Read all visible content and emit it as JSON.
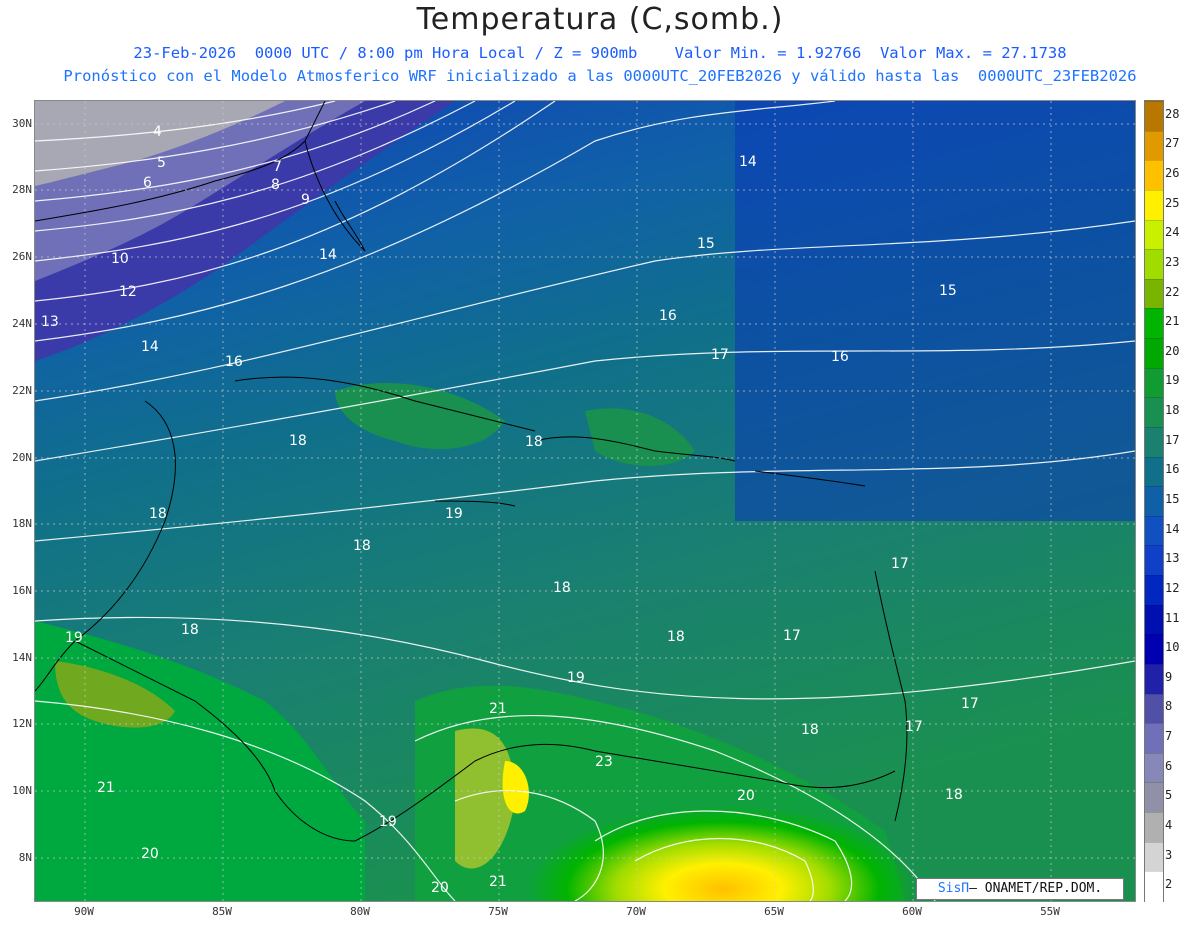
{
  "header": {
    "title": "Temperatura (C,somb.)",
    "line1": "23-Feb-2026  0000 UTC / 8:00 pm Hora Local / Z = 900mb    Valor Min. = 1.92766  Valor Max. = 27.1738",
    "line2": "Pronóstico con el Modelo Atmosferico WRF inicializado a las 0000UTC_20FEB2026 y válido hasta las  0000UTC_23FEB2026"
  },
  "map": {
    "lat_labels": [
      "30N",
      "28N",
      "26N",
      "24N",
      "22N",
      "20N",
      "18N",
      "16N",
      "14N",
      "12N",
      "10N",
      "8N"
    ],
    "lon_labels": [
      "90W",
      "85W",
      "80W",
      "75W",
      "70W",
      "65W",
      "60W",
      "55W"
    ],
    "contour_labels": [
      "4",
      "5",
      "6",
      "7",
      "8",
      "9",
      "10",
      "12",
      "13",
      "14",
      "14",
      "14",
      "15",
      "15",
      "16",
      "16",
      "16",
      "17",
      "17",
      "17",
      "17",
      "17",
      "18",
      "18",
      "18",
      "18",
      "18",
      "18",
      "18",
      "18",
      "18",
      "19",
      "19",
      "19",
      "19",
      "20",
      "20",
      "20",
      "21",
      "21",
      "21",
      "23"
    ]
  },
  "colorbar": {
    "levels": [
      "28",
      "27",
      "26",
      "25",
      "24",
      "23",
      "22",
      "21",
      "20",
      "19",
      "18",
      "17",
      "16",
      "15",
      "14",
      "13",
      "12",
      "11",
      "10",
      "9",
      "8",
      "7",
      "6",
      "5",
      "4",
      "3",
      "2"
    ],
    "colors": [
      "#b87800",
      "#e09a00",
      "#ffc000",
      "#fff000",
      "#c8f000",
      "#a0dc00",
      "#78b400",
      "#00b400",
      "#00a800",
      "#109c30",
      "#1a9050",
      "#1a8070",
      "#10708a",
      "#1060a8",
      "#1050c0",
      "#1040c8",
      "#0028c0",
      "#0010b0",
      "#0000b0",
      "#2020a8",
      "#5050a8",
      "#7070b8",
      "#8888b8",
      "#9090a8",
      "#b0b0b0",
      "#d4d4d4",
      "#ffffff"
    ]
  },
  "credit": {
    "brand": "SisΠ",
    "text": "– ONAMET/REP.DOM."
  }
}
